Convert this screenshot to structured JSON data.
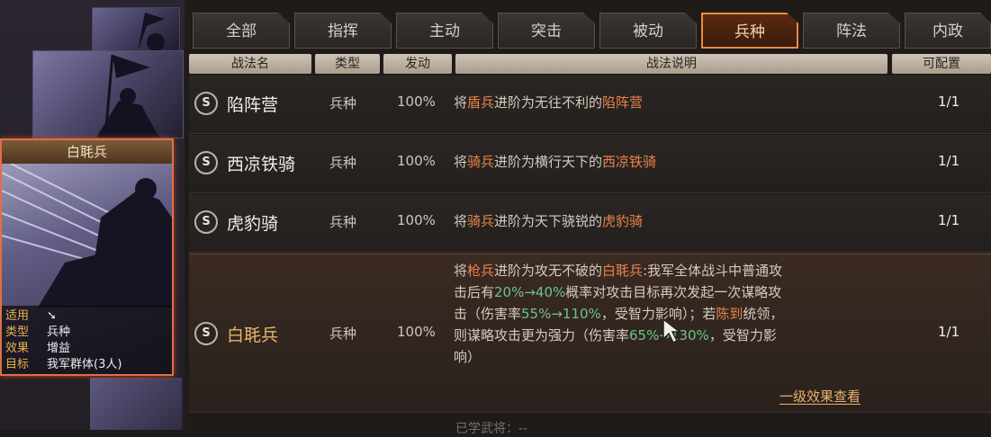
{
  "tabs": [
    {
      "label": "全部"
    },
    {
      "label": "指挥"
    },
    {
      "label": "主动"
    },
    {
      "label": "突击"
    },
    {
      "label": "被动"
    },
    {
      "label": "兵种"
    },
    {
      "label": "阵法"
    },
    {
      "label": "内政"
    }
  ],
  "active_tab": "兵种",
  "headers": {
    "name": "战法名",
    "type": "类型",
    "rate": "发动",
    "desc": "战法说明",
    "cfg": "可配置"
  },
  "rows": [
    {
      "badge": "S",
      "name": "陷阵营",
      "type": "兵种",
      "rate": "100%",
      "desc": {
        "a": "将",
        "b": "盾兵",
        "c": "进阶为无往不利的",
        "d": "陷阵营"
      },
      "cfg": "1/1"
    },
    {
      "badge": "S",
      "name": "西凉铁骑",
      "type": "兵种",
      "rate": "100%",
      "desc": {
        "a": "将",
        "b": "骑兵",
        "c": "进阶为横行天下的",
        "d": "西凉铁骑"
      },
      "cfg": "1/1"
    },
    {
      "badge": "S",
      "name": "虎豹骑",
      "type": "兵种",
      "rate": "100%",
      "desc": {
        "a": "将",
        "b": "骑兵",
        "c": "进阶为天下骁锐的",
        "d": "虎豹骑"
      },
      "cfg": "1/1"
    },
    {
      "badge": "S",
      "name": "白毦兵",
      "type": "兵种",
      "rate": "100%",
      "cfg": "1/1",
      "desc_lines": {
        "l1": {
          "a": "将",
          "b": "枪兵",
          "c": "进阶为攻无不破的",
          "d": "白毦兵",
          "e": ":我军全体战斗中普通攻"
        },
        "l2": {
          "a": "击后有",
          "b": "20%→40%",
          "c": "概率对攻击目标再次发起一次谋略攻"
        },
        "l3": {
          "a": "击（伤害率",
          "b": "55%→110%",
          "c": "，受智力影响）；若",
          "d": "陈到",
          "e": "统领，"
        },
        "l4": {
          "a": "则谋略攻击更为强力（伤害率",
          "b": "65%→130%",
          "c": "，受智力影"
        },
        "l5": "响）"
      },
      "effect_link": "一级效果查看"
    }
  ],
  "extra_label": "已学武将：--",
  "card": {
    "title": "白毦兵",
    "rows": [
      {
        "k": "适用",
        "v": ""
      },
      {
        "k": "类型",
        "v": "兵种"
      },
      {
        "k": "效果",
        "v": "增益"
      },
      {
        "k": "目标",
        "v": "我军群体(3人)"
      }
    ]
  },
  "colors": {
    "accent": "#e9834b",
    "highlight_green": "#6fc48a",
    "active_tab_border": "#f08a40"
  }
}
